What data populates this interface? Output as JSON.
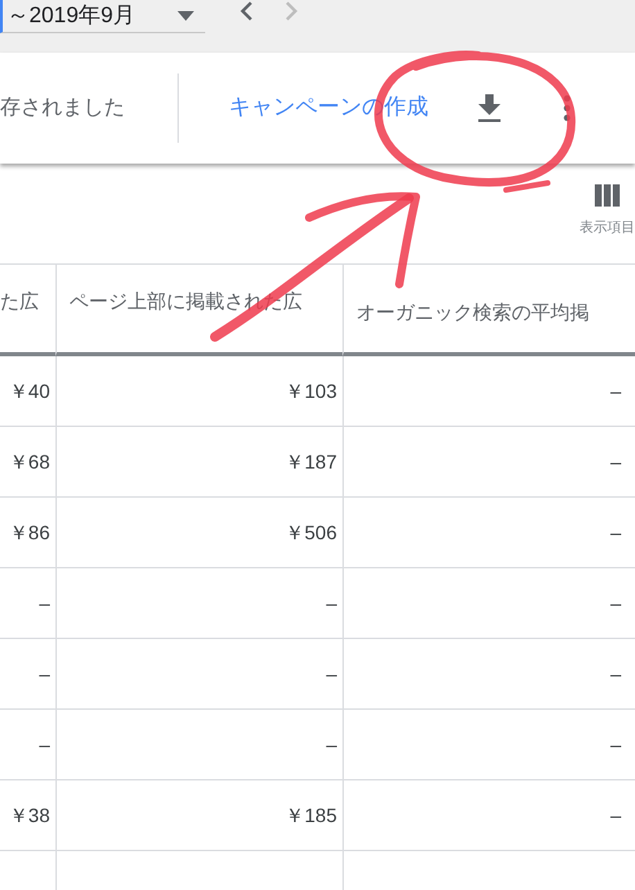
{
  "date_range": {
    "value": "～2019年9月",
    "prev_disabled": false,
    "next_disabled": true
  },
  "toolbar": {
    "status": "存されました",
    "create_link": "キャンペーンの作成"
  },
  "columns_button": {
    "label": "表示項目"
  },
  "table": {
    "columns": [
      "た広",
      "ページ上部に掲載された広",
      "オーガニック検索の平均掲"
    ],
    "rows": [
      [
        "￥40",
        "￥103",
        "–"
      ],
      [
        "￥68",
        "￥187",
        "–"
      ],
      [
        "￥86",
        "￥506",
        "–"
      ],
      [
        "–",
        "–",
        "–"
      ],
      [
        "–",
        "–",
        "–"
      ],
      [
        "–",
        "–",
        "–"
      ],
      [
        "￥38",
        "￥185",
        "–"
      ]
    ]
  }
}
